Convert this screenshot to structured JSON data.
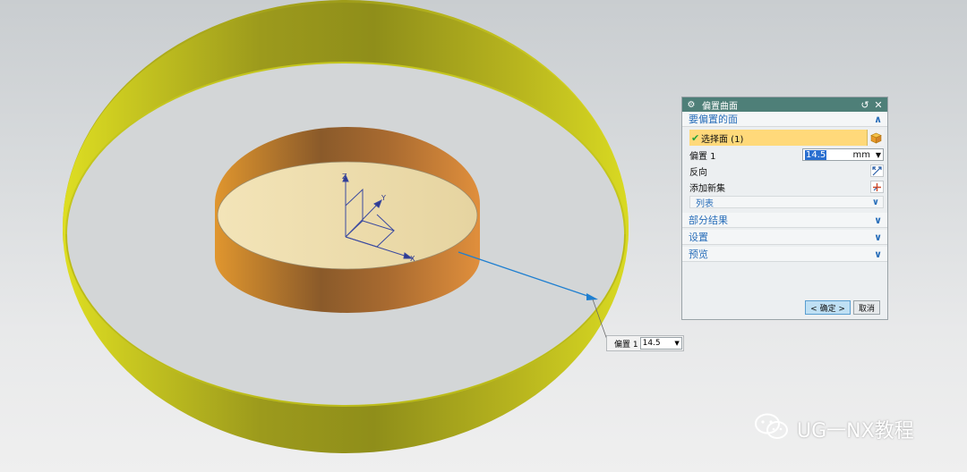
{
  "dialog": {
    "title": "偏置曲面",
    "sections": {
      "faces_to_offset": "要偏置的面",
      "partial_results": "部分结果",
      "settings": "设置",
      "preview": "预览"
    },
    "select_face_label": "选择面 (1)",
    "offset_label": "偏置 1",
    "offset_value": "14.5",
    "offset_unit": "mm",
    "reverse_label": "反向",
    "add_new_set_label": "添加新集",
    "list_label": "列表",
    "ok_label": "< 确定 >",
    "cancel_label": "取消"
  },
  "screen_input": {
    "label": "偏置 1",
    "value": "14.5"
  },
  "axis_labels": {
    "x": "X",
    "y": "Y",
    "z": "Z"
  },
  "watermark": {
    "text": "UG一NX教程"
  },
  "colors": {
    "titlebar": "#4e7f78",
    "section_text": "#2a6fba",
    "selection_highlight": "#ffd97a",
    "ring": "#c9c81e",
    "cylinder": "#c07a30",
    "cylinder_top": "#efdfb0",
    "leader_line": "#1e7fd0"
  },
  "icons": [
    "settings-gear-icon",
    "reset-icon",
    "close-icon",
    "checkmark-icon",
    "face-cube-icon",
    "reverse-direction-icon",
    "add-set-icon",
    "chevron-up-icon",
    "chevron-down-icon",
    "wechat-icon"
  ]
}
